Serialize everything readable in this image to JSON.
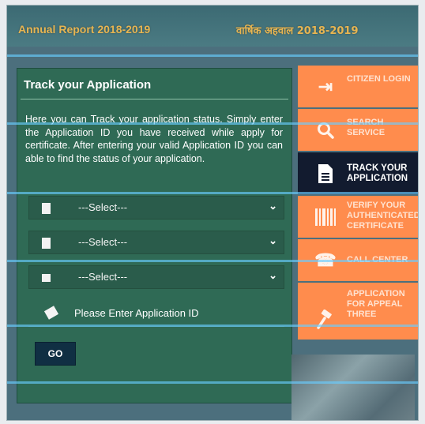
{
  "header": {
    "report_en": "Annual Report 2018-2019",
    "report_hi": "वार्षिक अहवाल 2018-2019"
  },
  "panel": {
    "title": "Track your Application",
    "description": "Here you can Track your application status. Simply enter the Application ID you have received while apply for certificate. After entering your valid Application ID you can able to find the status of your application.",
    "selects": [
      {
        "selected": "---Select---",
        "icon": "document-icon"
      },
      {
        "selected": "---Select---",
        "icon": "document-icon"
      },
      {
        "selected": "---Select---",
        "icon": "card-icon"
      }
    ],
    "application_id_placeholder": "Please Enter Application ID",
    "go_label": "GO"
  },
  "menu": {
    "items": [
      {
        "label": "CITIZEN LOGIN",
        "icon": "login-icon",
        "active": false
      },
      {
        "label": "SEARCH SERVICE",
        "icon": "search-icon",
        "active": false
      },
      {
        "label": "TRACK YOUR APPLICATION",
        "icon": "file-icon",
        "active": true
      },
      {
        "label": "VERIFY YOUR AUTHENTICATED CERTIFICATE",
        "icon": "barcode-icon",
        "active": false
      },
      {
        "label": "CALL CENTER",
        "icon": "phone-icon",
        "active": false
      },
      {
        "label": "APPLICATION FOR APPEAL THREE",
        "icon": "gavel-icon",
        "active": false
      }
    ]
  },
  "colors": {
    "panel_green": "#2f6a55",
    "menu_orange": "#ff8c4d",
    "menu_active": "#121b2f",
    "header_gold": "#e7b552"
  }
}
